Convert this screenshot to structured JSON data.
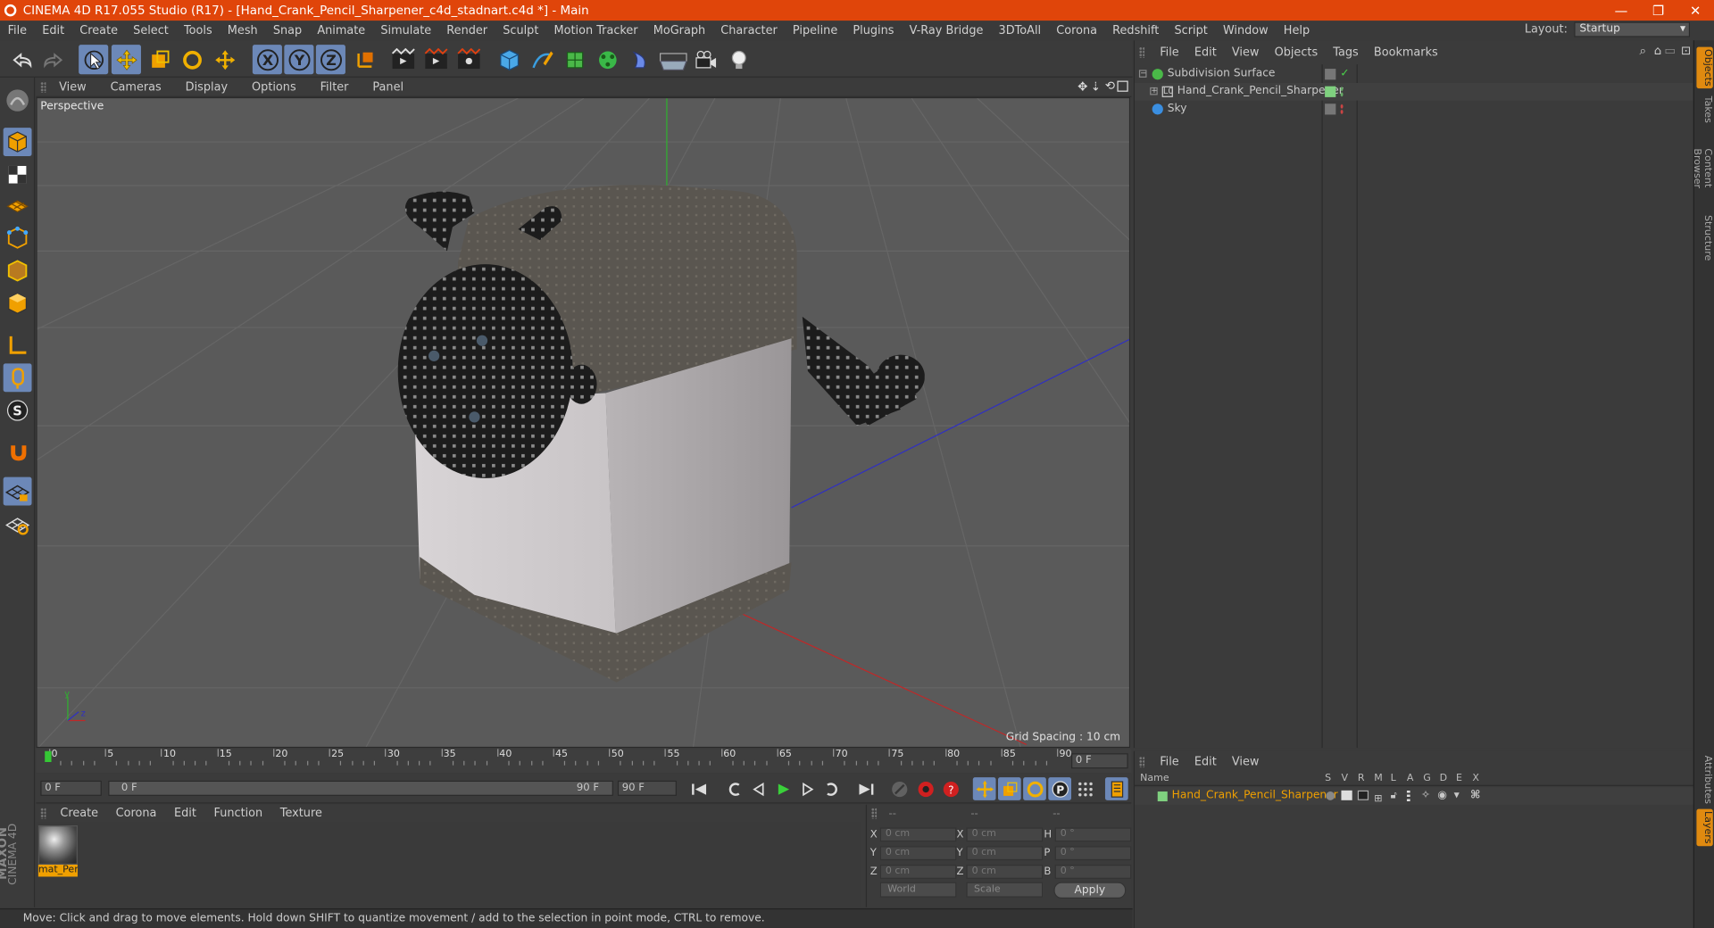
{
  "window": {
    "title": "CINEMA 4D R17.055 Studio (R17) - [Hand_Crank_Pencil_Sharpener_c4d_stadnart.c4d *] - Main"
  },
  "menubar": {
    "items": [
      "File",
      "Edit",
      "Create",
      "Select",
      "Tools",
      "Mesh",
      "Snap",
      "Animate",
      "Simulate",
      "Render",
      "Sculpt",
      "Motion Tracker",
      "MoGraph",
      "Character",
      "Pipeline",
      "Plugins",
      "V-Ray Bridge",
      "3DToAll",
      "Corona",
      "Redshift",
      "Script",
      "Window",
      "Help"
    ],
    "layout_label": "Layout:",
    "layout_value": "Startup"
  },
  "viewport": {
    "menu": [
      "View",
      "Cameras",
      "Display",
      "Options",
      "Filter",
      "Panel"
    ],
    "camera_label": "Perspective",
    "grid_spacing": "Grid Spacing : 10 cm"
  },
  "timeline": {
    "ticks": [
      "0",
      "5",
      "10",
      "15",
      "20",
      "25",
      "30",
      "35",
      "40",
      "45",
      "50",
      "55",
      "60",
      "65",
      "70",
      "75",
      "80",
      "85",
      "90"
    ],
    "current_frame": "0 F"
  },
  "transport": {
    "start": "0 F",
    "range_start": "0 F",
    "range_end": "90 F",
    "end": "90 F"
  },
  "material_manager": {
    "menu": [
      "Create",
      "Corona",
      "Edit",
      "Function",
      "Texture"
    ],
    "materials": [
      {
        "name": "mat_Per"
      }
    ]
  },
  "coordinates": {
    "header": [
      "--",
      "--",
      "--"
    ],
    "rows": [
      {
        "a": "X",
        "av": "0 cm",
        "b": "X",
        "bv": "0 cm",
        "c": "H",
        "cv": "0 °"
      },
      {
        "a": "Y",
        "av": "0 cm",
        "b": "Y",
        "bv": "0 cm",
        "c": "P",
        "cv": "0 °"
      },
      {
        "a": "Z",
        "av": "0 cm",
        "b": "Z",
        "bv": "0 cm",
        "c": "B",
        "cv": "0 °"
      }
    ],
    "mode": "World",
    "size_mode": "Scale",
    "apply": "Apply"
  },
  "status": {
    "text": "Move: Click and drag to move elements. Hold down SHIFT to quantize movement / add to the selection in point mode, CTRL to remove."
  },
  "object_manager": {
    "menu": [
      "File",
      "Edit",
      "View",
      "Objects",
      "Tags",
      "Bookmarks"
    ],
    "objects": [
      {
        "name": "Subdivision Surface"
      },
      {
        "name": "Hand_Crank_Pencil_Sharpener"
      },
      {
        "name": "Sky"
      }
    ]
  },
  "layer_manager": {
    "menu": [
      "File",
      "Edit",
      "View"
    ],
    "columns": [
      "Name",
      "S",
      "V",
      "R",
      "M",
      "L",
      "A",
      "G",
      "D",
      "E",
      "X"
    ],
    "layers": [
      {
        "name": "Hand_Crank_Pencil_Sharpener",
        "color": "#7fd07f"
      }
    ]
  },
  "right_tabs": [
    "Objects",
    "Takes",
    "Content Browser",
    "Structure",
    "Attributes",
    "Layers"
  ],
  "brand": {
    "maxon": "MAXON",
    "c4d": "CINEMA 4D"
  },
  "colors": {
    "title_bar": "#e0450a",
    "accent_blue": "#6c88b8",
    "active_orange": "#e08a10"
  }
}
